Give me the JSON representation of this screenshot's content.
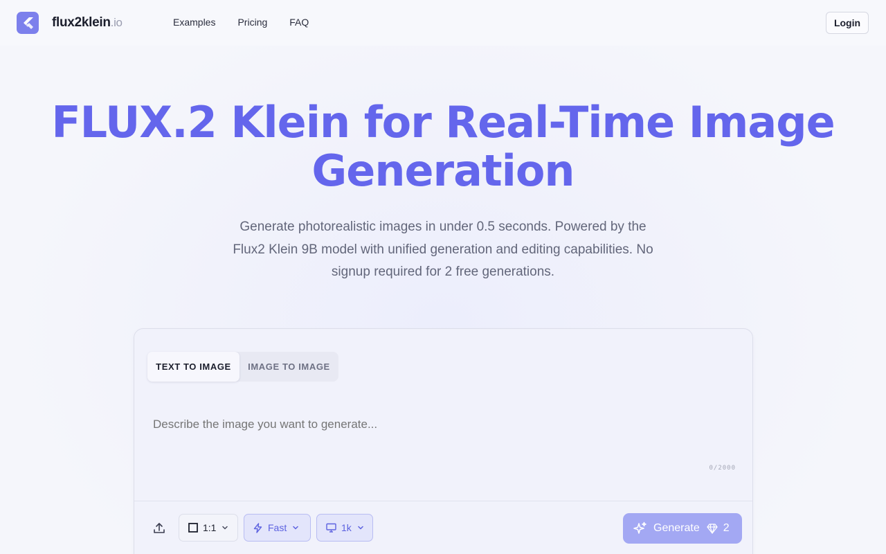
{
  "app": {
    "logo_text": "flux2klein",
    "logo_suffix": ".io"
  },
  "nav": {
    "items": [
      "Examples",
      "Pricing",
      "FAQ"
    ],
    "login_label": "Login"
  },
  "hero": {
    "title_line1": "FLUX.2 Klein for Real-Time Image",
    "title_line2": "Generation",
    "subtitle_line1": "Generate photorealistic images in under 0.5 seconds. Powered by the",
    "subtitle_line2": "Flux2 Klein 9B model with unified generation and editing capabilities. No",
    "subtitle_line3": "signup required for 2 free generations."
  },
  "generator": {
    "tabs": [
      {
        "label": "TEXT TO IMAGE",
        "active": true
      },
      {
        "label": "IMAGE TO IMAGE",
        "active": false
      }
    ],
    "prompt_placeholder": "Describe the image you want to generate...",
    "char_counter": "0/2000",
    "aspect_ratio": "1:1",
    "speed": "Fast",
    "resolution": "1k",
    "generate_label": "Generate",
    "generate_cost": "2"
  },
  "colors": {
    "accent": "#6466ec",
    "logo_bg": "#7c80ec",
    "generate_bg": "#a3a8f3",
    "pill_bg": "#e3e5fb"
  },
  "icons": {
    "logo": "flutter-like-logo-icon",
    "upload": "upload-icon",
    "ratio": "square-icon",
    "speed": "lightning-icon",
    "resolution": "monitor-icon",
    "chevron": "chevron-down-icon",
    "generate": "sparkles-icon",
    "credits": "gem-icon"
  }
}
